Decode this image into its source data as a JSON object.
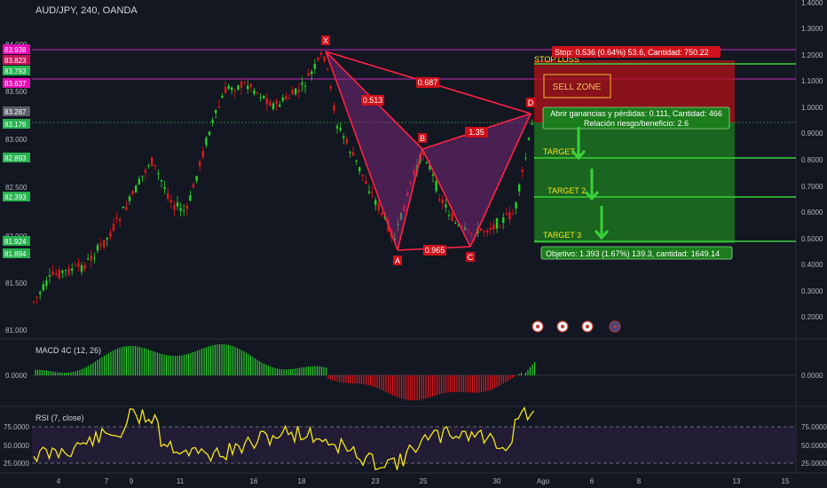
{
  "header": {
    "title": "AUD/JPY, 240, OANDA"
  },
  "colors": {
    "bg": "#131722",
    "bull": "#26d126",
    "bear": "#e0161b",
    "pattern": "#ff2244",
    "magenta": "#c02cc0",
    "sell": "#b31218",
    "target": "#1e8f1e",
    "rsi": "#f5e61a",
    "label_bg": "#d0111b"
  },
  "left_axis": {
    "ticks": [
      "84.000",
      "83.500",
      "83.000",
      "82.500",
      "82.000",
      "81.500",
      "81.000"
    ],
    "tags": [
      {
        "label": "83.938",
        "color": "#e60cb5"
      },
      {
        "label": "83.823",
        "color": "#c7145c"
      },
      {
        "label": "83.793",
        "color": "#26b34f"
      },
      {
        "label": "83.637",
        "color": "#e60cb5"
      },
      {
        "label": "83.287",
        "color": "#5d606b"
      },
      {
        "label": "83.176",
        "color": "#26b34f"
      },
      {
        "label": "82.893",
        "color": "#26b34f"
      },
      {
        "label": "82.393",
        "color": "#26b34f"
      },
      {
        "label": "81.924",
        "color": "#26b34f"
      },
      {
        "label": "81.894",
        "color": "#26b34f"
      }
    ]
  },
  "right_axis": {
    "ticks": [
      "1.4000",
      "1.3000",
      "1.2000",
      "1.1000",
      "1.0000",
      "0.9000",
      "0.8000",
      "0.7000",
      "0.6000",
      "0.5000",
      "0.4000",
      "0.3000",
      "0.2000"
    ],
    "macd_tick": "0.0000",
    "rsi_ticks": [
      "75.0000",
      "50.0000",
      "25.0000"
    ]
  },
  "bottom_axis": {
    "ticks": [
      "4",
      "7",
      "9",
      "11",
      "16",
      "18",
      "23",
      "25",
      "30",
      "Ago",
      "6",
      "8",
      "13",
      "15"
    ]
  },
  "pattern": {
    "points": [
      "X",
      "A",
      "B",
      "C",
      "D"
    ],
    "ratios": {
      "xb": "0.513",
      "xd": "0.687",
      "bd": "1.35",
      "ac": "0.965"
    }
  },
  "trade": {
    "stop_label": "Stop: 0.536 (0.64%) 53.6, Cantidad: 750.22",
    "stop_loss": "STOP LOSS",
    "sell_zone": "SELL  ZONE",
    "pnl_line1": "Abrir ganancias y pérdidas: 0.111, Cantidad: 466",
    "pnl_line2": "Relación riesgo/beneficio: 2.6",
    "target1": "TARGET",
    "target2": "TARGET 2",
    "target3": "TARGET 3",
    "objective": "Objetivo: 1.393 (1.67%) 139.3, cantidad: 1649.14"
  },
  "macd": {
    "label": "MACD 4C (12, 26)"
  },
  "rsi": {
    "label": "RSI (7, close)"
  }
}
